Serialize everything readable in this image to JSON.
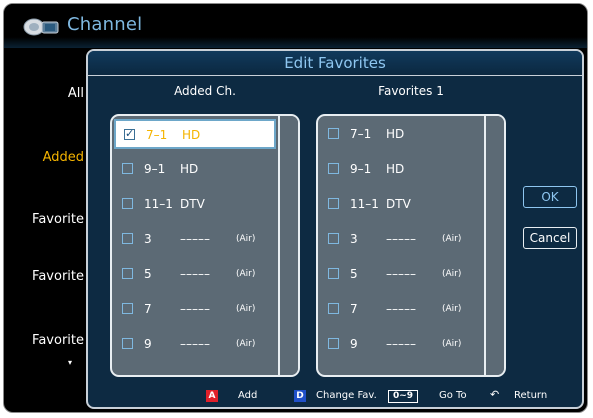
{
  "app": {
    "title": "Channel",
    "icon": "satellite-dish-icon"
  },
  "sidebar": {
    "items": [
      {
        "label": "All",
        "active": false
      },
      {
        "label": "Added",
        "active": true
      },
      {
        "label": "Favorite",
        "active": false
      },
      {
        "label": "Favorite",
        "active": false
      },
      {
        "label": "Favorite",
        "active": false
      }
    ],
    "more_icon": "▾"
  },
  "dialog": {
    "title": "Edit Favorites",
    "left_header": "Added Ch.",
    "right_header": "Favorites 1",
    "left_rows": [
      {
        "num": "7–1",
        "name": "HD",
        "air": "",
        "checked": true,
        "selected": true
      },
      {
        "num": "9–1",
        "name": "HD",
        "air": "",
        "checked": false,
        "selected": false
      },
      {
        "num": "11–1",
        "name": "DTV",
        "air": "",
        "checked": false,
        "selected": false
      },
      {
        "num": "3",
        "name": "–––––",
        "air": "(Air)",
        "checked": false,
        "selected": false
      },
      {
        "num": "5",
        "name": "–––––",
        "air": "(Air)",
        "checked": false,
        "selected": false
      },
      {
        "num": "7",
        "name": "–––––",
        "air": "(Air)",
        "checked": false,
        "selected": false
      },
      {
        "num": "9",
        "name": "–––––",
        "air": "(Air)",
        "checked": false,
        "selected": false
      }
    ],
    "right_rows": [
      {
        "num": "7–1",
        "name": "HD",
        "air": "",
        "checked": false
      },
      {
        "num": "9–1",
        "name": "HD",
        "air": "",
        "checked": false
      },
      {
        "num": "11–1",
        "name": "DTV",
        "air": "",
        "checked": false
      },
      {
        "num": "3",
        "name": "–––––",
        "air": "(Air)",
        "checked": false
      },
      {
        "num": "5",
        "name": "–––––",
        "air": "(Air)",
        "checked": false
      },
      {
        "num": "7",
        "name": "–––––",
        "air": "(Air)",
        "checked": false
      },
      {
        "num": "9",
        "name": "–––––",
        "air": "(Air)",
        "checked": false
      }
    ],
    "ok_label": "OK",
    "cancel_label": "Cancel"
  },
  "footer": {
    "add_key": "A",
    "add_label": "Add",
    "change_key": "D",
    "change_label": "Change Fav.",
    "goto_key": "0~9",
    "goto_label": "Go To",
    "return_icon": "↶",
    "return_label": "Return"
  },
  "colors": {
    "accent_blue": "#8ec6f0",
    "selected_yellow": "#f5b400",
    "panel_gray": "#5c6a75",
    "dialog_bg": "#0d2a42",
    "red_key": "#e0202a",
    "blue_key": "#2050c8"
  }
}
